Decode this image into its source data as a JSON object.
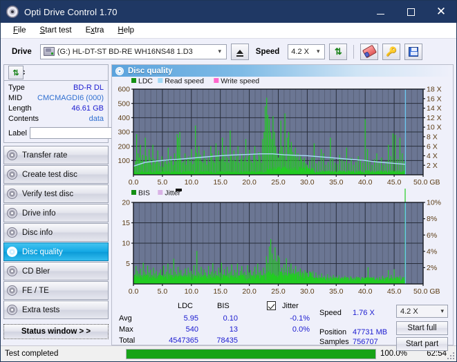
{
  "window": {
    "title": "Opti Drive Control 1.70",
    "icon": "disc-icon",
    "minimize": "minimize-icon",
    "maximize": "maximize-icon",
    "close": "close-icon"
  },
  "menu": [
    {
      "label": "File",
      "accel": "F"
    },
    {
      "label": "Start test",
      "accel": "S"
    },
    {
      "label": "Extra",
      "accel": "x"
    },
    {
      "label": "Help",
      "accel": "H"
    }
  ],
  "toolbar": {
    "drive_label": "Drive",
    "drive_value": "(G:)   HL-DT-ST BD-RE  WH16NS48 1.D3",
    "eject_icon": "eject-icon",
    "speed_label": "Speed",
    "speed_value": "4.2 X",
    "refresh_icon": "refresh-icon",
    "erase_icon": "eraser-icon",
    "key_icon": "key-icon",
    "save_icon": "save-icon"
  },
  "disc": {
    "title": "Disc",
    "refresh_icon": "refresh-icon",
    "rows": [
      {
        "key": "Type",
        "value": "BD-R DL",
        "link": false
      },
      {
        "key": "MID",
        "value": "CMCMAGDI6 (000)",
        "link": true
      },
      {
        "key": "Length",
        "value": "46.61 GB",
        "link": false
      },
      {
        "key": "Contents",
        "value": "data",
        "link": true
      }
    ],
    "label_key": "Label",
    "label_value": "",
    "label_placeholder": "",
    "label_button_icon": "cd-icon"
  },
  "nav": {
    "items": [
      {
        "label": "Transfer rate",
        "selected": false
      },
      {
        "label": "Create test disc",
        "selected": false
      },
      {
        "label": "Verify test disc",
        "selected": false
      },
      {
        "label": "Drive info",
        "selected": false
      },
      {
        "label": "Disc info",
        "selected": false
      },
      {
        "label": "Disc quality",
        "selected": true
      },
      {
        "label": "CD Bler",
        "selected": false
      },
      {
        "label": "FE / TE",
        "selected": false
      },
      {
        "label": "Extra tests",
        "selected": false
      }
    ],
    "status_window": "Status window > >"
  },
  "panel": {
    "header_icon": "disc-quality-icon",
    "header_title": "Disc quality"
  },
  "stats": {
    "col_ldc": "LDC",
    "col_bis": "BIS",
    "jitter_label": "Jitter",
    "jitter_checked": true,
    "rows": [
      {
        "key": "Avg",
        "ldc": "5.95",
        "bis": "0.10",
        "jitter": "-0.1%"
      },
      {
        "key": "Max",
        "ldc": "540",
        "bis": "13",
        "jitter": "0.0%"
      },
      {
        "key": "Total",
        "ldc": "4547365",
        "bis": "78435",
        "jitter": ""
      }
    ],
    "speed_key": "Speed",
    "speed_value": "1.76 X",
    "position_key": "Position",
    "position_value": "47731 MB",
    "samples_key": "Samples",
    "samples_value": "756707",
    "speed_select": "4.2 X",
    "start_full": "Start full",
    "start_part": "Start part"
  },
  "statusbar": {
    "text": "Test completed",
    "percent_label": "100.0%",
    "percent": 100,
    "time": "62:54"
  },
  "colors": {
    "accent": "#13a8e4",
    "ldc_green": "#22cc22",
    "read_speed": "#9fd8f5",
    "write_speed": "#ff66cc",
    "jitter": "#d9b3e6",
    "plot_bg": "#6b7693",
    "title_bar": "#1f3864",
    "value_blue": "#1a1ad0",
    "progress_green": "#17a317"
  },
  "chart_data": [
    {
      "type": "line",
      "name": "disc-quality-ldc",
      "title": "",
      "xlabel": "GB",
      "ylabel": "LDC",
      "xlim": [
        0,
        50
      ],
      "ylim": [
        0,
        600
      ],
      "y2lim": [
        0,
        18
      ],
      "y2label": "X",
      "xticks": [
        0.0,
        5.0,
        10.0,
        15.0,
        20.0,
        25.0,
        30.0,
        35.0,
        40.0,
        45.0,
        50.0
      ],
      "xticklabels": [
        "0.0",
        "5.0",
        "10.0",
        "15.0",
        "20.0",
        "25.0",
        "30.0",
        "35.0",
        "40.0",
        "45.0",
        "50.0 GB"
      ],
      "yticks": [
        100,
        200,
        300,
        400,
        500,
        600
      ],
      "y2ticks": [
        2,
        4,
        6,
        8,
        10,
        12,
        14,
        16,
        18
      ],
      "y2ticklabels": [
        "2 X",
        "4 X",
        "6 X",
        "8 X",
        "10 X",
        "12 X",
        "14 X",
        "16 X",
        "18 X"
      ],
      "grid": true,
      "legend": [
        {
          "label": "LDC",
          "color": "#149014"
        },
        {
          "label": "Read speed",
          "color": "#9fd8f5"
        },
        {
          "label": "Write speed",
          "color": "#ff66cc"
        }
      ],
      "series": [
        {
          "name": "LDC",
          "kind": "impulse",
          "color": "#22cc22",
          "x": [
            0.15,
            0.35,
            0.55,
            0.8,
            1.0,
            1.2,
            1.4,
            1.6,
            1.85,
            2.05,
            2.25,
            2.5,
            2.7,
            2.9,
            3.1,
            3.35,
            3.55,
            3.8,
            4.0,
            4.2,
            4.45,
            4.65,
            4.9,
            5.1,
            5.3,
            5.55,
            5.75,
            6.0,
            6.2,
            6.45,
            6.65,
            6.9,
            7.1,
            7.3,
            7.55,
            7.75,
            7.95,
            8.0,
            8.2,
            8.45,
            8.65,
            8.9,
            9.1,
            9.35,
            9.55,
            9.8,
            10.0,
            10.25,
            10.45,
            10.7,
            10.9,
            11.1,
            11.3,
            11.55,
            11.75,
            12.0,
            12.2,
            12.45,
            12.65,
            12.9,
            13.1,
            13.35,
            13.55,
            13.8,
            14.0,
            14.25,
            14.45,
            14.7,
            14.9,
            15.15,
            15.35,
            15.6,
            15.8,
            16.0,
            16.25,
            16.45,
            16.7,
            16.9,
            17.15,
            17.35,
            17.6,
            17.8,
            18.05,
            18.25,
            18.5,
            18.7,
            18.95,
            19.15,
            19.4,
            19.6,
            19.85,
            20.05,
            20.3,
            20.5,
            20.75,
            20.95,
            21.2,
            21.4,
            21.65,
            21.85,
            22.1,
            22.3,
            22.55,
            22.75,
            23.0,
            23.2,
            23.45,
            23.65,
            23.9,
            24.1,
            24.35,
            24.55,
            24.8,
            25.0,
            25.25,
            25.45,
            25.7,
            25.9,
            26.15,
            26.35,
            26.6,
            26.8,
            27.05,
            27.25,
            27.5,
            27.7,
            27.95,
            28.15,
            28.4,
            28.6,
            28.85,
            29.05,
            29.3,
            29.5,
            29.75,
            30.0,
            30.4,
            30.8,
            31.2,
            31.6,
            32.0,
            32.4,
            32.8,
            33.2,
            33.6,
            34.0,
            34.4,
            34.8,
            35.2,
            35.6,
            36.0,
            36.4,
            36.8,
            37.2,
            37.6,
            38.0,
            38.4,
            38.8,
            39.2,
            39.6,
            40.0,
            40.4,
            40.8,
            41.2,
            41.6,
            42.0,
            42.4,
            42.8,
            43.2,
            43.6,
            44.0,
            44.4,
            44.8,
            45.2,
            45.6,
            46.0,
            46.4,
            46.8
          ],
          "y": [
            60,
            95,
            285,
            150,
            120,
            210,
            95,
            140,
            75,
            260,
            130,
            90,
            180,
            120,
            70,
            210,
            110,
            80,
            100,
            170,
            85,
            60,
            130,
            55,
            90,
            110,
            75,
            190,
            85,
            130,
            100,
            70,
            150,
            95,
            285,
            260,
            140,
            300,
            120,
            85,
            95,
            150,
            70,
            110,
            130,
            90,
            180,
            75,
            100,
            345,
            155,
            120,
            200,
            140,
            95,
            85,
            170,
            110,
            70,
            130,
            90,
            200,
            150,
            100,
            85,
            220,
            130,
            170,
            95,
            110,
            260,
            150,
            90,
            200,
            120,
            85,
            310,
            140,
            100,
            170,
            95,
            130,
            200,
            85,
            110,
            150,
            95,
            120,
            250,
            90,
            130,
            175,
            100,
            85,
            140,
            200,
            110,
            95,
            160,
            130,
            85,
            250,
            300,
            480,
            540,
            420,
            390,
            300,
            250,
            410,
            300,
            200,
            150,
            120,
            170,
            380,
            200,
            150,
            430,
            100,
            260,
            300,
            180,
            230,
            160,
            140,
            190,
            120,
            150,
            100,
            130,
            110,
            90,
            120,
            80,
            70,
            100,
            120,
            220,
            80,
            95,
            180,
            150,
            70,
            90,
            260,
            120,
            85,
            75,
            140,
            110,
            95,
            190,
            80,
            120,
            70,
            90,
            130,
            100,
            85,
            390,
            180,
            95,
            70,
            110,
            150,
            85,
            120,
            70,
            95,
            210,
            130,
            290,
            280,
            110,
            260,
            150,
            95
          ]
        },
        {
          "name": "Read speed",
          "kind": "line",
          "color": "#a8dcf7",
          "x": [
            0,
            2,
            4,
            6,
            8,
            10,
            12,
            14,
            16,
            18,
            20,
            22,
            24,
            25,
            26,
            28,
            30,
            32,
            34,
            36,
            38,
            40,
            42,
            44,
            46,
            46.9
          ],
          "y_axis": "right",
          "y": [
            1.8,
            2.6,
            2.9,
            3.1,
            3.3,
            3.5,
            3.7,
            3.9,
            4.1,
            4.2,
            4.3,
            4.4,
            4.4,
            4.3,
            4.2,
            4.1,
            4.0,
            3.8,
            3.6,
            3.4,
            3.2,
            3.0,
            2.7,
            2.5,
            2.3,
            2.2
          ]
        },
        {
          "name": "end-marker",
          "kind": "vline",
          "color": "#6ec8f0",
          "x": [
            46.95
          ]
        }
      ]
    },
    {
      "type": "line",
      "name": "disc-quality-bis-jitter",
      "title": "",
      "xlabel": "GB",
      "ylabel": "BIS",
      "xlim": [
        0,
        50
      ],
      "ylim": [
        0,
        20
      ],
      "y2lim": [
        0,
        10
      ],
      "y2label": "%",
      "xticks": [
        0.0,
        5.0,
        10.0,
        15.0,
        20.0,
        25.0,
        30.0,
        35.0,
        40.0,
        45.0,
        50.0
      ],
      "xticklabels": [
        "0.0",
        "5.0",
        "10.0",
        "15.0",
        "20.0",
        "25.0",
        "30.0",
        "35.0",
        "40.0",
        "45.0",
        "50.0 GB"
      ],
      "yticks": [
        5,
        10,
        15,
        20
      ],
      "y2ticks": [
        2,
        4,
        6,
        8,
        10
      ],
      "y2ticklabels": [
        "2%",
        "4%",
        "6%",
        "8%",
        "10%"
      ],
      "grid": true,
      "legend": [
        {
          "label": "BIS",
          "color": "#149014"
        },
        {
          "label": "Jitter",
          "color": "#d9b3e6"
        }
      ],
      "series": [
        {
          "name": "BIS",
          "kind": "impulse",
          "color": "#22cc22",
          "x": [
            0.2,
            0.45,
            0.7,
            0.95,
            1.2,
            1.45,
            1.7,
            1.95,
            2.2,
            2.45,
            2.7,
            2.95,
            3.2,
            3.45,
            3.7,
            3.95,
            4.2,
            4.45,
            4.7,
            4.95,
            5.2,
            5.45,
            5.7,
            5.95,
            6.2,
            6.45,
            6.7,
            6.95,
            7.2,
            7.45,
            7.7,
            7.95,
            8.2,
            8.45,
            8.7,
            8.95,
            9.2,
            9.45,
            9.7,
            9.95,
            10.2,
            10.45,
            10.7,
            10.95,
            11.2,
            11.45,
            11.7,
            11.95,
            12.2,
            12.45,
            12.7,
            12.95,
            13.2,
            13.45,
            13.7,
            13.95,
            14.2,
            14.45,
            14.7,
            14.95,
            15.2,
            15.45,
            15.7,
            15.95,
            16.2,
            16.45,
            16.7,
            16.95,
            17.2,
            17.45,
            17.7,
            17.95,
            18.2,
            18.45,
            18.7,
            18.95,
            19.2,
            19.45,
            19.7,
            19.95,
            20.2,
            20.45,
            20.7,
            20.95,
            21.2,
            21.45,
            21.7,
            21.95,
            22.2,
            22.45,
            22.7,
            22.95,
            23.2,
            23.45,
            23.7,
            23.95,
            24.2,
            24.45,
            24.7,
            24.95,
            25.2,
            25.6,
            26.0,
            26.4,
            26.8,
            27.2,
            27.6,
            28.0,
            28.4,
            28.8,
            29.2,
            29.6,
            30.0,
            30.5,
            31.0,
            31.5,
            32.0,
            32.5,
            33.0,
            33.5,
            34.0,
            34.5,
            35.0,
            35.5,
            36.0,
            36.5,
            37.0,
            37.5,
            38.0,
            38.5,
            39.0,
            39.5,
            40.0,
            40.5,
            41.0,
            41.5,
            42.0,
            42.5,
            43.0,
            43.5,
            44.0,
            44.5,
            45.0,
            45.5,
            46.0,
            46.5,
            46.9
          ],
          "y": [
            2.0,
            4.4,
            3.2,
            2.5,
            3.8,
            2.2,
            5.2,
            3.0,
            2.4,
            4.5,
            2.8,
            3.5,
            2.2,
            4.0,
            2.6,
            3.2,
            2.0,
            2.8,
            3.6,
            2.2,
            4.5,
            2.4,
            3.0,
            5.0,
            2.6,
            3.8,
            2.2,
            6.2,
            3.0,
            2.4,
            4.2,
            2.8,
            3.4,
            2.0,
            2.6,
            3.8,
            2.2,
            4.0,
            2.8,
            3.2,
            2.4,
            4.6,
            2.0,
            8.1,
            3.0,
            2.6,
            4.2,
            2.2,
            3.6,
            2.8,
            2.0,
            4.4,
            2.4,
            3.0,
            5.1,
            2.6,
            3.2,
            2.0,
            4.0,
            2.8,
            5.2,
            2.4,
            3.6,
            2.0,
            4.2,
            2.6,
            3.0,
            4.8,
            2.2,
            3.4,
            2.8,
            5.0,
            2.0,
            3.2,
            4.4,
            2.6,
            3.0,
            2.2,
            4.6,
            2.8,
            3.4,
            2.0,
            3.0,
            4.2,
            2.4,
            5.0,
            2.8,
            3.2,
            2.0,
            4.0,
            2.6,
            6.8,
            5.2,
            9.2,
            11.0,
            7.5,
            6.0,
            9.0,
            5.5,
            7.0,
            6.5,
            4.0,
            4.8,
            6.3,
            4.2,
            5.0,
            3.6,
            4.4,
            3.0,
            3.8,
            2.8,
            3.4,
            2.6,
            3.0,
            2.4,
            2.8,
            2.2,
            2.6,
            2.0,
            2.4,
            1.9,
            2.2,
            1.8,
            2.1,
            1.7,
            2.0,
            1.6,
            1.9,
            1.5,
            1.8,
            1.6,
            1.7,
            1.5,
            4.1,
            1.6,
            1.8,
            1.5,
            1.7,
            2.0,
            1.6,
            3.4,
            2.2,
            3.6,
            1.8,
            2.0,
            1.7
          ]
        },
        {
          "name": "end-marker",
          "kind": "vline",
          "color": "#6ec8f0",
          "x": [
            46.95
          ]
        }
      ]
    }
  ]
}
